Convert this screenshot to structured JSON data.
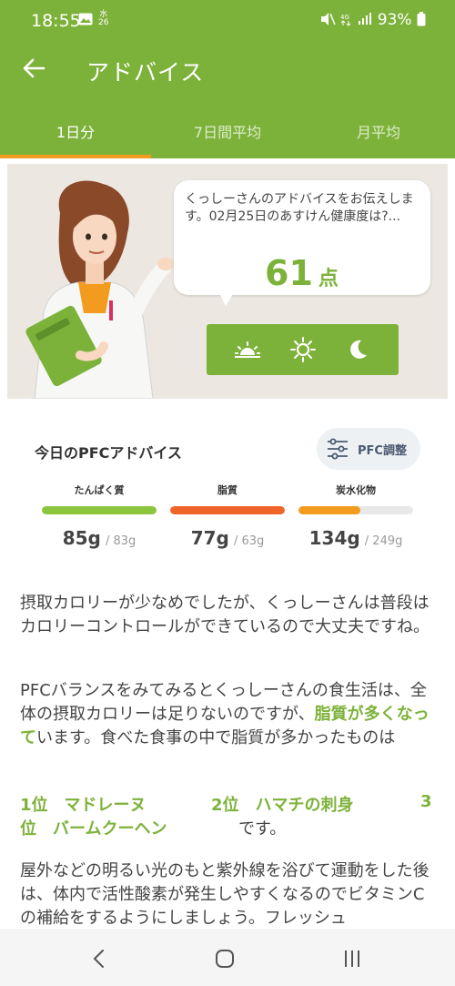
{
  "status_bar": {
    "time": "18:55",
    "day_badge": "水\n26",
    "battery": "93%"
  },
  "app_bar": {
    "title": "アドバイス"
  },
  "tabs": [
    {
      "label": "1日分"
    },
    {
      "label": "7日間平均"
    },
    {
      "label": "月平均"
    }
  ],
  "advice": {
    "message": "くっしーさんのアドバイスをお伝えします。02月25日のあすけん健康度は?...",
    "score": "61",
    "score_unit": "点"
  },
  "pfc": {
    "title": "今日のPFCアドバイス",
    "adjust_button": "PFC調整",
    "nutrients": [
      {
        "name": "たんぱく質",
        "value": "85",
        "unit": "g",
        "target": "83g",
        "ratio": 1.0,
        "color": "#8cc63f"
      },
      {
        "name": "脂質",
        "value": "77",
        "unit": "g",
        "target": "63g",
        "ratio": 1.0,
        "color": "#f0642a"
      },
      {
        "name": "炭水化物",
        "value": "134",
        "unit": "g",
        "target": "249g",
        "ratio": 0.54,
        "color": "#f39b1e"
      }
    ]
  },
  "body": {
    "p1": "摂取カロリーが少なめでしたが、くっしーさんは普段はカロリーコントロールができているので大丈夫ですね。",
    "p2_a": "PFCバランスをみてみるとくっしーさんの食生活は、全体の摂取カロリーは足りないのですが、",
    "p2_hl": "脂質が多くなって",
    "p2_b": "います。食べた食事の中で脂質が多かったものは",
    "rank1": "1位　マドレーヌ",
    "rank2": "2位　ハマチの刺身",
    "rank3_num": "3",
    "rank3_line2": "位　バームクーヘン",
    "rank_suffix": "です。",
    "p3": "屋外などの明るい光のもと紫外線を浴びて運動をした後は、体内で活性酸素が発生しやすくなるのでビタミンCの補給をするようにしましょう。フレッシュ"
  }
}
